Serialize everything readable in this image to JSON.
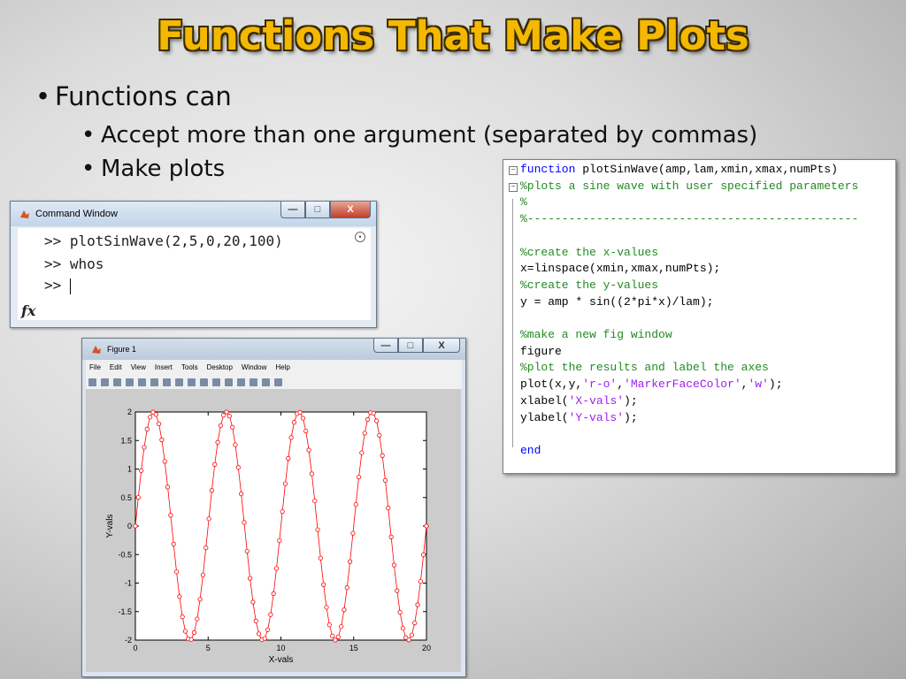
{
  "slide": {
    "title": "Functions That Make Plots",
    "bullets": [
      {
        "text": "Functions can"
      },
      {
        "text": "Accept more than one argument (separated by commas)"
      },
      {
        "text": "Make plots"
      }
    ]
  },
  "command_window": {
    "title": "Command Window",
    "lines": [
      ">> plotSinWave(2,5,0,20,100)",
      ">> whos",
      ">> "
    ],
    "fx_label": "fx",
    "buttons": {
      "minimize": "—",
      "maximize": "□",
      "close": "X"
    }
  },
  "figure_window": {
    "title": "Figure 1",
    "menu": [
      "File",
      "Edit",
      "View",
      "Insert",
      "Tools",
      "Desktop",
      "Window",
      "Help"
    ],
    "buttons": {
      "minimize": "—",
      "maximize": "□",
      "close": "X"
    }
  },
  "chart_data": {
    "type": "line",
    "title": "",
    "xlabel": "X-vals",
    "ylabel": "Y-vals",
    "xlim": [
      0,
      20
    ],
    "ylim": [
      -2,
      2
    ],
    "xticks": [
      0,
      5,
      10,
      15,
      20
    ],
    "yticks": [
      -2,
      -1.5,
      -1,
      -0.5,
      0,
      0.5,
      1,
      1.5,
      2
    ],
    "grid": false,
    "series": [
      {
        "function": "y = 2 * sin(2*pi*x/5)",
        "x_start": 0,
        "x_end": 20,
        "num_points": 100,
        "line_color": "#ff0000",
        "marker": "o",
        "marker_face_color": "#ffffff"
      }
    ]
  },
  "editor": {
    "lines": [
      [
        {
          "t": "function",
          "c": "kw"
        },
        {
          "t": " plotSinWave(amp,lam,xmin,xmax,numPts)",
          "c": ""
        }
      ],
      [
        {
          "t": "%plots a sine wave with user specified parameters",
          "c": "cm"
        }
      ],
      [
        {
          "t": "%",
          "c": "cm"
        }
      ],
      [
        {
          "t": "%------------------------------------------------",
          "c": "cm"
        }
      ],
      [],
      [
        {
          "t": "%create the x-values",
          "c": "cm"
        }
      ],
      [
        {
          "t": "x=linspace(xmin,xmax,numPts);",
          "c": ""
        }
      ],
      [
        {
          "t": "%create the y-values",
          "c": "cm"
        }
      ],
      [
        {
          "t": "y = amp * sin((2*pi*x)/lam);",
          "c": ""
        }
      ],
      [],
      [
        {
          "t": "%make a new fig window",
          "c": "cm"
        }
      ],
      [
        {
          "t": "figure",
          "c": ""
        }
      ],
      [
        {
          "t": "%plot the results and label the axes",
          "c": "cm"
        }
      ],
      [
        {
          "t": "plot(x,y,",
          "c": ""
        },
        {
          "t": "'r-o'",
          "c": "st"
        },
        {
          "t": ",",
          "c": ""
        },
        {
          "t": "'MarkerFaceColor'",
          "c": "st"
        },
        {
          "t": ",",
          "c": ""
        },
        {
          "t": "'w'",
          "c": "st"
        },
        {
          "t": ");",
          "c": ""
        }
      ],
      [
        {
          "t": "xlabel(",
          "c": ""
        },
        {
          "t": "'X-vals'",
          "c": "st"
        },
        {
          "t": ");",
          "c": ""
        }
      ],
      [
        {
          "t": "ylabel(",
          "c": ""
        },
        {
          "t": "'Y-vals'",
          "c": "st"
        },
        {
          "t": ");",
          "c": ""
        }
      ],
      [],
      [
        {
          "t": "end",
          "c": "kw"
        }
      ]
    ]
  }
}
